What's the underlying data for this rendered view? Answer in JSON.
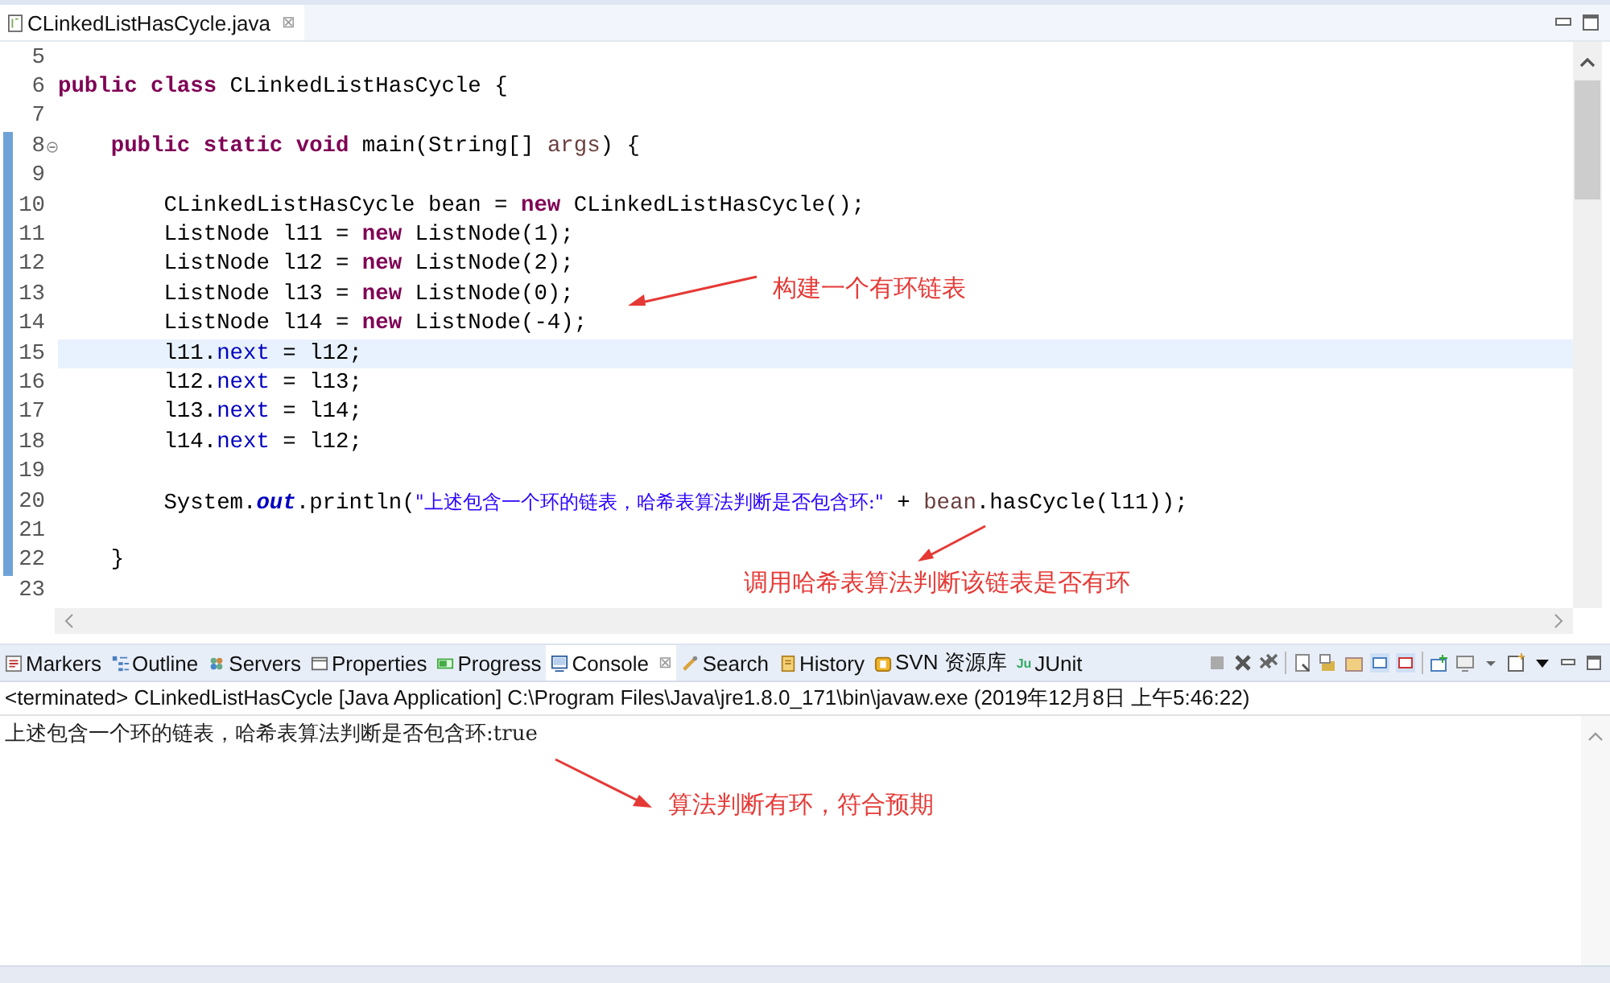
{
  "editor_tab": {
    "title": "CLinkedListHasCycle.java",
    "close": "⊠"
  },
  "code_lines": [
    {
      "number": "5",
      "changed": false,
      "current": false,
      "fold": false
    },
    {
      "number": "6",
      "changed": false,
      "current": false,
      "fold": false,
      "segments": [
        {
          "kind": "keyword",
          "text": "public class"
        },
        {
          "kind": "plain",
          "text": " CLinkedListHasCycle {"
        }
      ]
    },
    {
      "number": "7",
      "changed": false,
      "current": false,
      "fold": false
    },
    {
      "number": "8",
      "changed": true,
      "current": false,
      "fold": true,
      "segments": [
        {
          "kind": "keyword",
          "text": "    public static void"
        },
        {
          "kind": "plain",
          "text": " main(String[] "
        },
        {
          "kind": "variable",
          "text": "args"
        },
        {
          "kind": "plain",
          "text": ") {"
        }
      ]
    },
    {
      "number": "9",
      "changed": true,
      "current": false,
      "fold": false
    },
    {
      "number": "10",
      "changed": true,
      "current": false,
      "fold": false,
      "segments": [
        {
          "kind": "plain",
          "text": "        CLinkedListHasCycle bean = "
        },
        {
          "kind": "keyword",
          "text": "new"
        },
        {
          "kind": "plain",
          "text": " CLinkedListHasCycle();"
        }
      ]
    },
    {
      "number": "11",
      "changed": true,
      "current": false,
      "fold": false,
      "segments": [
        {
          "kind": "plain",
          "text": "        ListNode l11 = "
        },
        {
          "kind": "keyword",
          "text": "new"
        },
        {
          "kind": "plain",
          "text": " ListNode(1);"
        }
      ]
    },
    {
      "number": "12",
      "changed": true,
      "current": false,
      "fold": false,
      "segments": [
        {
          "kind": "plain",
          "text": "        ListNode l12 = "
        },
        {
          "kind": "keyword",
          "text": "new"
        },
        {
          "kind": "plain",
          "text": " ListNode(2);"
        }
      ]
    },
    {
      "number": "13",
      "changed": true,
      "current": false,
      "fold": false,
      "segments": [
        {
          "kind": "plain",
          "text": "        ListNode l13 = "
        },
        {
          "kind": "keyword",
          "text": "new"
        },
        {
          "kind": "plain",
          "text": " ListNode(0);"
        }
      ]
    },
    {
      "number": "14",
      "changed": true,
      "current": false,
      "fold": false,
      "segments": [
        {
          "kind": "plain",
          "text": "        ListNode l14 = "
        },
        {
          "kind": "keyword",
          "text": "new"
        },
        {
          "kind": "plain",
          "text": " ListNode(-4);"
        }
      ]
    },
    {
      "number": "15",
      "changed": true,
      "current": true,
      "fold": false,
      "segments": [
        {
          "kind": "plain",
          "text": "        l11."
        },
        {
          "kind": "field",
          "text": "next"
        },
        {
          "kind": "plain",
          "text": " = l12;"
        }
      ]
    },
    {
      "number": "16",
      "changed": true,
      "current": false,
      "fold": false,
      "segments": [
        {
          "kind": "plain",
          "text": "        l12."
        },
        {
          "kind": "field",
          "text": "next"
        },
        {
          "kind": "plain",
          "text": " = l13;"
        }
      ]
    },
    {
      "number": "17",
      "changed": true,
      "current": false,
      "fold": false,
      "segments": [
        {
          "kind": "plain",
          "text": "        l13."
        },
        {
          "kind": "field",
          "text": "next"
        },
        {
          "kind": "plain",
          "text": " = l14;"
        }
      ]
    },
    {
      "number": "18",
      "changed": true,
      "current": false,
      "fold": false,
      "segments": [
        {
          "kind": "plain",
          "text": "        l14."
        },
        {
          "kind": "field",
          "text": "next"
        },
        {
          "kind": "plain",
          "text": " = l12;"
        }
      ]
    },
    {
      "number": "19",
      "changed": true,
      "current": false,
      "fold": false
    },
    {
      "number": "20",
      "changed": true,
      "current": false,
      "fold": false,
      "segments": [
        {
          "kind": "plain",
          "text": "        System."
        },
        {
          "kind": "static",
          "text": "out"
        },
        {
          "kind": "plain",
          "text": ".println("
        },
        {
          "kind": "string",
          "text": "\"上述包含一个环的链表，哈希表算法判断是否包含环:\""
        },
        {
          "kind": "plain",
          "text": " + "
        },
        {
          "kind": "variable",
          "text": "bean"
        },
        {
          "kind": "plain",
          "text": ".hasCycle(l11));"
        }
      ]
    },
    {
      "number": "21",
      "changed": true,
      "current": false,
      "fold": false
    },
    {
      "number": "22",
      "changed": true,
      "current": false,
      "fold": false,
      "segments": [
        {
          "kind": "plain",
          "text": "    }"
        }
      ]
    },
    {
      "number": "23",
      "changed": false,
      "current": false,
      "fold": false
    }
  ],
  "panel_tabs": [
    {
      "label": "Markers",
      "selected": false
    },
    {
      "label": "Outline",
      "selected": false
    },
    {
      "label": "Servers",
      "selected": false
    },
    {
      "label": "Properties",
      "selected": false
    },
    {
      "label": "Progress",
      "selected": false
    },
    {
      "label": "Console",
      "selected": true,
      "close": "⊠"
    },
    {
      "label": "Search",
      "selected": false
    },
    {
      "label": "History",
      "selected": false
    },
    {
      "label": "SVN 资源库",
      "selected": false
    },
    {
      "label": "JUnit",
      "selected": false,
      "icon_text": "Ju"
    }
  ],
  "console": {
    "header": "<terminated> CLinkedListHasCycle [Java Application] C:\\Program Files\\Java\\jre1.8.0_171\\bin\\javaw.exe (2019年12月8日 上午5:46:22)",
    "output": "上述包含一个环的链表，哈希表算法判断是否包含环:true"
  },
  "annotations": [
    {
      "text": "构建一个有环链表"
    },
    {
      "text": "调用哈希表算法判断该链表是否有环"
    },
    {
      "text": "算法判断有环，符合预期"
    }
  ]
}
